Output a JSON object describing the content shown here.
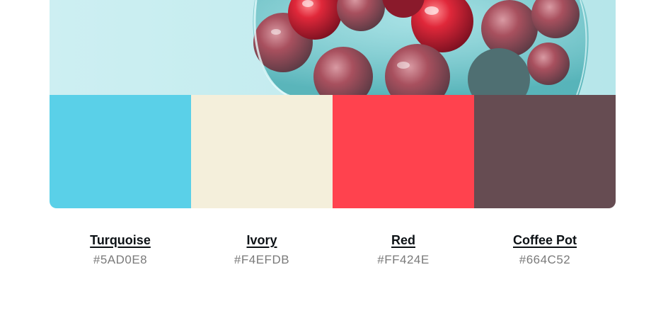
{
  "palette": {
    "colors": [
      {
        "name": "Turquoise",
        "hex": "#5AD0E8",
        "swatch_color": "#5AD0E8"
      },
      {
        "name": "Ivory",
        "hex": "#F4EFDB",
        "swatch_color": "#F4EFDB"
      },
      {
        "name": "Red",
        "hex": "#FF424E",
        "swatch_color": "#FF424E"
      },
      {
        "name": "Coffee Pot",
        "hex": "#664C52",
        "swatch_color": "#664C52"
      }
    ]
  }
}
